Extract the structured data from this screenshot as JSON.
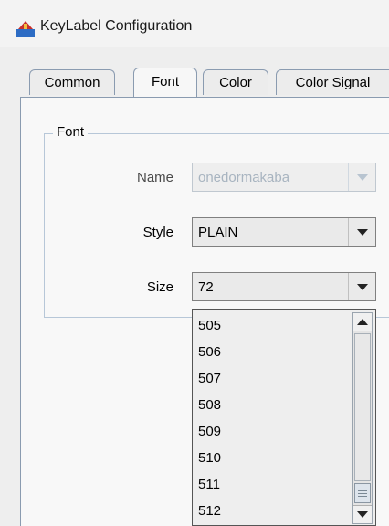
{
  "window": {
    "title": "KeyLabel Configuration",
    "icon": "app-icon"
  },
  "tabs": [
    {
      "label": "Common",
      "active": false
    },
    {
      "label": "Font",
      "active": true
    },
    {
      "label": "Color",
      "active": false
    },
    {
      "label": "Color Signal",
      "active": false
    }
  ],
  "font_group": {
    "legend": "Font",
    "name_label": "Name",
    "name_value": "onedormakaba",
    "name_enabled": false,
    "style_label": "Style",
    "style_value": "PLAIN",
    "size_label": "Size",
    "size_value": "72"
  },
  "size_dropdown": {
    "items": [
      "505",
      "506",
      "507",
      "508",
      "509",
      "510",
      "511",
      "512"
    ],
    "scroll_fraction": 0.95
  },
  "colors": {
    "tab_border": "#8a9bb0",
    "disabled_text": "#a8b4c0"
  }
}
